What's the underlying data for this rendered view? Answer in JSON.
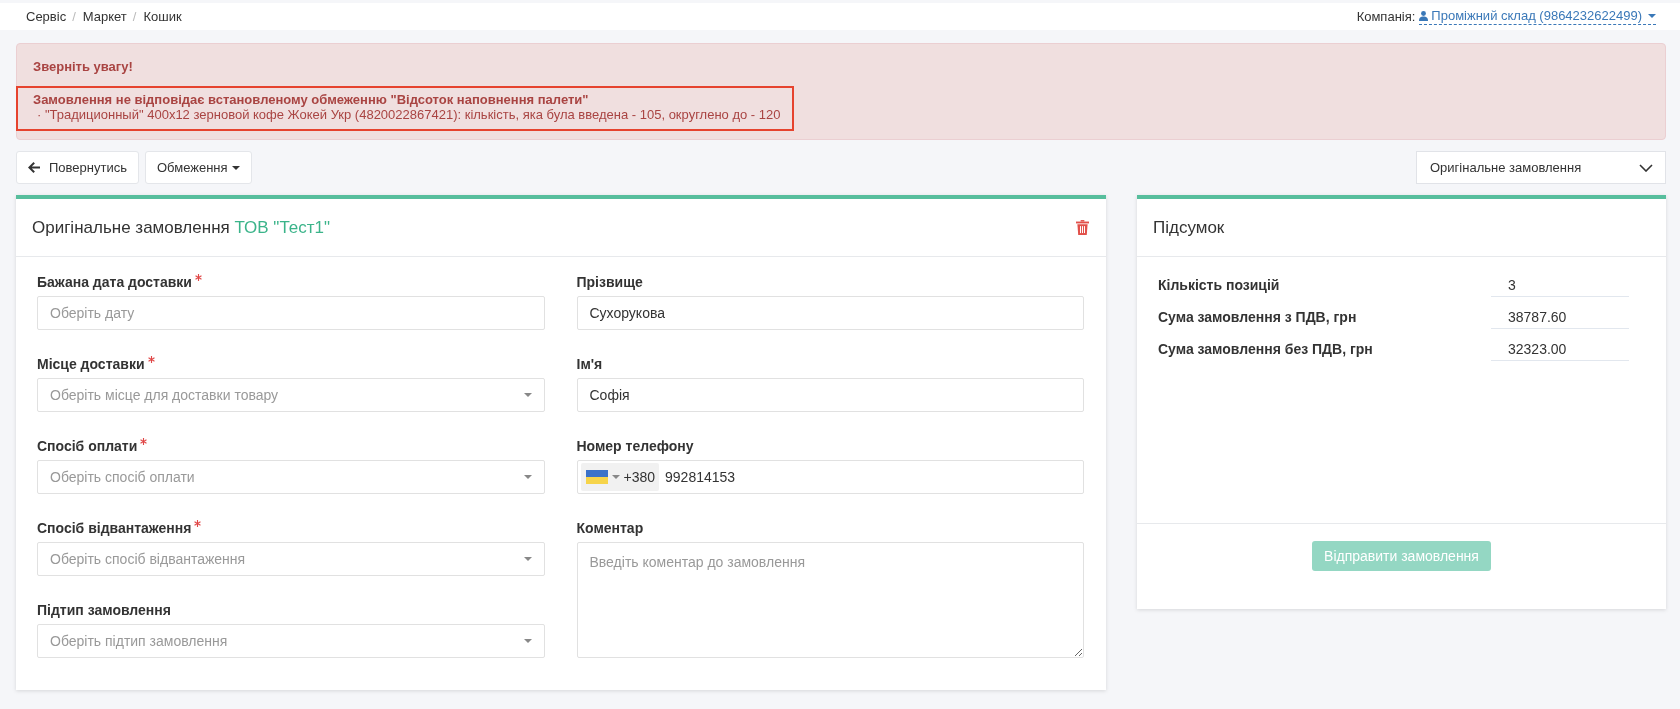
{
  "breadcrumbs": [
    {
      "label": "Сервіс",
      "separator": "/"
    },
    {
      "label": "Маркет",
      "separator": "/"
    },
    {
      "label": "Кошик"
    }
  ],
  "company": {
    "label": "Компанія:",
    "value": "Проміжний склад (9864232622499)"
  },
  "alert": {
    "title": "Зверніть увагу!",
    "highlighted": true,
    "message": "Замовлення не відповідає встановленому обмеженню \"Відсоток наповнення палети\"",
    "items": [
      "· \"Традиционный\" 400x12 зерновой кофе Жокей Укр (4820022867421): кількість, яка була введена - 105, округлено до - 120"
    ]
  },
  "toolbar": {
    "back_button": "Повернутись",
    "limits_button": "Обмеження",
    "view_select": {
      "value": "Оригінальне замовлення"
    }
  },
  "order_card": {
    "title": "Оригінальне замовлення",
    "company": "ТОВ \"Тест1\"",
    "columns": [
      [
        {
          "kind": "date",
          "label": "Бажана дата доставки",
          "required": true,
          "placeholder": "Оберіть дату"
        },
        {
          "kind": "select",
          "label": "Місце доставки",
          "required": true,
          "placeholder": "Оберіть місце для доставки товару"
        },
        {
          "kind": "select",
          "label": "Спосіб оплати",
          "required": true,
          "placeholder": "Оберіть спосіб оплати"
        },
        {
          "kind": "select",
          "label": "Спосіб відвантаження",
          "required": true,
          "placeholder": "Оберіть спосіб відвантаження"
        },
        {
          "kind": "select",
          "label": "Підтип замовлення",
          "required": false,
          "placeholder": "Оберіть підтип замовлення"
        }
      ],
      [
        {
          "kind": "text",
          "label": "Прізвище",
          "required": false,
          "value": "Сухорукова"
        },
        {
          "kind": "text",
          "label": "Ім'я",
          "required": false,
          "value": "Софія"
        },
        {
          "kind": "phone",
          "label": "Номер телефону",
          "required": false,
          "code": "+380",
          "value": "992814153"
        },
        {
          "kind": "textarea",
          "label": "Коментар",
          "required": false,
          "placeholder": "Введіть коментар до замовлення"
        }
      ]
    ]
  },
  "summary": {
    "title": "Підсумок",
    "rows": [
      {
        "label": "Кількість позицій",
        "value": "3"
      },
      {
        "label": "Сума замовлення з ПДВ, грн",
        "value": "38787.60"
      },
      {
        "label": "Сума замовлення без ПДВ, грн",
        "value": "32323.00"
      }
    ],
    "submit_button": {
      "label": "Відправити замовлення",
      "disabled": true
    }
  }
}
